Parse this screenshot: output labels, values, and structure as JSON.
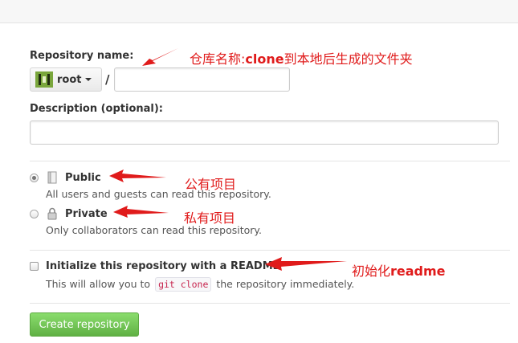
{
  "form": {
    "repo_name_label": "Repository name:",
    "owner": "root",
    "slash": "/",
    "repo_name_value": "",
    "description_label": "Description (optional):",
    "description_value": "",
    "visibility": {
      "selected": "public",
      "public": {
        "title": "Public",
        "note": "All users and guests can read this repository."
      },
      "private": {
        "title": "Private",
        "note": "Only collaborators can read this repository."
      }
    },
    "readme": {
      "checked": false,
      "label": "Initialize this repository with a README",
      "note_before": "This will allow you to",
      "note_code": "git clone",
      "note_after": "the repository immediately."
    },
    "create_button": "Create repository"
  },
  "annotations": {
    "repo_name_pre": "仓库名称:",
    "repo_name_bold": "clone",
    "repo_name_post": "到本地后生成的文件夹",
    "public": "公有项目",
    "private": "私有项目",
    "readme_pre": "初始化",
    "readme_bold": "readme"
  },
  "colors": {
    "annotation": "#e01b1b",
    "create_button": "#60b044",
    "owner_avatar": "#7aa63c"
  },
  "icons": [
    "book-icon",
    "lock-icon",
    "chevron-down-icon"
  ]
}
